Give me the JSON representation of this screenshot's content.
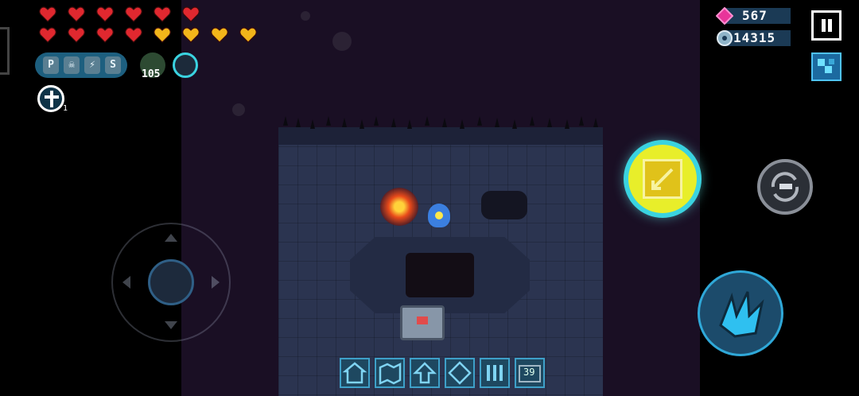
{
  "hud": {
    "hearts_red": 10,
    "hearts_gold": 4,
    "buffs": [
      "P",
      "☠",
      "⚡",
      "S"
    ],
    "weapon_ammo": "105",
    "revive_count": "1",
    "gems": "567",
    "coins": "14315"
  },
  "item_bar": {
    "slots": [
      "house-icon",
      "map-icon",
      "upgrade-icon",
      "gem-icon",
      "grid-icon",
      "counter-icon"
    ],
    "last_slot_count": "39"
  },
  "colors": {
    "heart_red": "#e0282f",
    "heart_gold": "#f2b51a",
    "accent_cyan": "#3ad3e0",
    "skill_yellow": "#e8ee2a"
  }
}
